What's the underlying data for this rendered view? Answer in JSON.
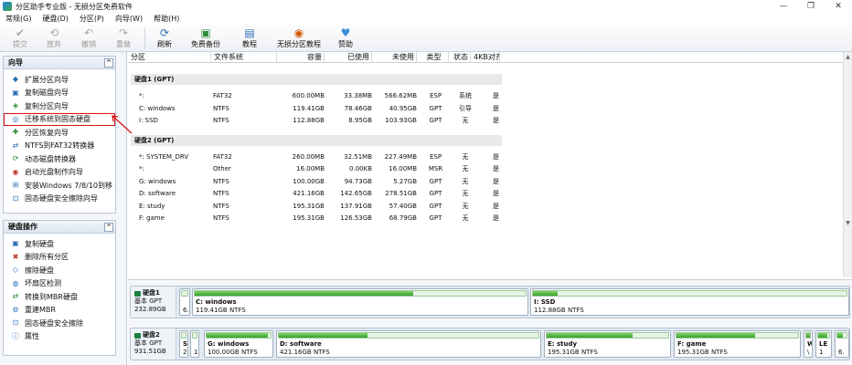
{
  "titlebar": {
    "title": "分区助手专业版 - 无损分区免费软件",
    "minimize": "—",
    "restore": "❐",
    "close": "✕"
  },
  "menu": [
    "常规(G)",
    "硬盘(D)",
    "分区(P)",
    "向导(W)",
    "帮助(H)"
  ],
  "toolbar": [
    {
      "label": "提交",
      "icon": "check-icon",
      "glyph": "✔",
      "enabled": false
    },
    {
      "label": "放弃",
      "icon": "discard-icon",
      "glyph": "⟲",
      "enabled": false
    },
    {
      "label": "撤销",
      "icon": "undo-icon",
      "glyph": "↶",
      "enabled": false
    },
    {
      "label": "重做",
      "icon": "redo-icon",
      "glyph": "↷",
      "enabled": false
    },
    {
      "label": "刷新",
      "icon": "refresh-icon",
      "glyph": "⟳",
      "enabled": true
    },
    {
      "label": "免费备份",
      "icon": "backup-icon",
      "glyph": "▣",
      "enabled": true
    },
    {
      "label": "教程",
      "icon": "tutorial-icon",
      "glyph": "▤",
      "enabled": true
    },
    {
      "label": "无损分区教程",
      "icon": "lossless-tutorial-icon",
      "glyph": "◉",
      "enabled": true
    },
    {
      "label": "赞助",
      "icon": "heart-icon",
      "glyph": "♥",
      "enabled": true
    }
  ],
  "wizard_panel": {
    "title": "向导",
    "collapse": "^",
    "items": [
      {
        "label": "扩展分区向导",
        "icon": "extend-partition-icon"
      },
      {
        "label": "复制磁盘向导",
        "icon": "copy-disk-icon"
      },
      {
        "label": "复制分区向导",
        "icon": "copy-partition-icon"
      },
      {
        "label": "迁移系统到固态硬盘",
        "icon": "migrate-os-icon",
        "selected": true
      },
      {
        "label": "分区恢复向导",
        "icon": "partition-recovery-icon"
      },
      {
        "label": "NTFS到FAT32转换器",
        "icon": "ntfs-fat32-converter-icon"
      },
      {
        "label": "动态磁盘转换器",
        "icon": "dynamic-disk-icon"
      },
      {
        "label": "启动光盘制作向导",
        "icon": "bootable-cd-icon"
      },
      {
        "label": "安装Windows 7/8/10到移",
        "icon": "windows-to-go-icon"
      },
      {
        "label": "固态硬盘安全擦除向导",
        "icon": "ssd-secure-erase-icon"
      }
    ]
  },
  "disk_ops_panel": {
    "title": "硬盘操作",
    "collapse": "^",
    "items": [
      {
        "label": "复制硬盘",
        "icon": "copy-disk-icon"
      },
      {
        "label": "删除所有分区",
        "icon": "delete-all-partitions-icon"
      },
      {
        "label": "擦除硬盘",
        "icon": "wipe-disk-icon"
      },
      {
        "label": "坏扇区检测",
        "icon": "bad-sector-icon"
      },
      {
        "label": "转换到MBR硬盘",
        "icon": "convert-mbr-icon"
      },
      {
        "label": "重建MBR",
        "icon": "rebuild-mbr-icon"
      },
      {
        "label": "固态硬盘安全擦除",
        "icon": "ssd-erase-icon"
      },
      {
        "label": "属性",
        "icon": "properties-icon"
      }
    ]
  },
  "table": {
    "columns": [
      "分区",
      "文件系统",
      "容量",
      "已使用",
      "未使用",
      "类型",
      "状态",
      "4KB对齐"
    ],
    "groups": [
      {
        "label": "硬盘1 (GPT)",
        "rows": [
          [
            "*:",
            "FAT32",
            "600.00MB",
            "33.38MB",
            "566.62MB",
            "ESP",
            "系统",
            "是"
          ],
          [
            "C: windows",
            "NTFS",
            "119.41GB",
            "78.46GB",
            "40.95GB",
            "GPT",
            "引导",
            "是"
          ],
          [
            "I: SSD",
            "NTFS",
            "112.88GB",
            "8.95GB",
            "103.93GB",
            "GPT",
            "无",
            "是"
          ]
        ]
      },
      {
        "label": "硬盘2 (GPT)",
        "rows": [
          [
            "*: SYSTEM_DRV",
            "FAT32",
            "260.00MB",
            "32.51MB",
            "227.49MB",
            "ESP",
            "无",
            "是"
          ],
          [
            "*:",
            "Other",
            "16.00MB",
            "0.00KB",
            "16.00MB",
            "MSR",
            "无",
            "是"
          ],
          [
            "G: windows",
            "NTFS",
            "100.00GB",
            "94.73GB",
            "5.27GB",
            "GPT",
            "无",
            "是"
          ],
          [
            "D: software",
            "NTFS",
            "421.16GB",
            "142.65GB",
            "278.51GB",
            "GPT",
            "无",
            "是"
          ],
          [
            "E: study",
            "NTFS",
            "195.31GB",
            "137.91GB",
            "57.40GB",
            "GPT",
            "无",
            "是"
          ],
          [
            "F: game",
            "NTFS",
            "195.31GB",
            "126.53GB",
            "68.79GB",
            "GPT",
            "无",
            "是"
          ]
        ]
      }
    ]
  },
  "disk_maps": [
    {
      "name": "硬盘1",
      "type": "基本 GPT",
      "size": "232.89GB",
      "partitions": [
        {
          "name": "",
          "size": "6.",
          "used_pct": 6
        },
        {
          "name": "C: windows",
          "size": "119.41GB NTFS",
          "used_pct": 66
        },
        {
          "name": "I: SSD",
          "size": "112.88GB NTFS",
          "used_pct": 8
        }
      ]
    },
    {
      "name": "硬盘2",
      "type": "基本 GPT",
      "size": "931.51GB",
      "partitions": [
        {
          "name": "S",
          "size": "2",
          "used_pct": 12
        },
        {
          "name": "",
          "size": "1",
          "used_pct": 0
        },
        {
          "name": "G: windows",
          "size": "100.00GB NTFS",
          "used_pct": 95
        },
        {
          "name": "D: software",
          "size": "421.16GB NTFS",
          "used_pct": 34
        },
        {
          "name": "E: study",
          "size": "195.31GB NTFS",
          "used_pct": 71
        },
        {
          "name": "F: game",
          "size": "195.31GB NTFS",
          "used_pct": 65
        },
        {
          "name": "W",
          "size": "\\",
          "used_pct": 90
        },
        {
          "name": "LE",
          "size": "1",
          "used_pct": 80
        },
        {
          "name": "",
          "size": "6.",
          "used_pct": 60
        }
      ]
    }
  ],
  "colors": {
    "accent": "#2b6fb6",
    "used_fill": "#39a12c",
    "selection_outline": "#d11111"
  }
}
